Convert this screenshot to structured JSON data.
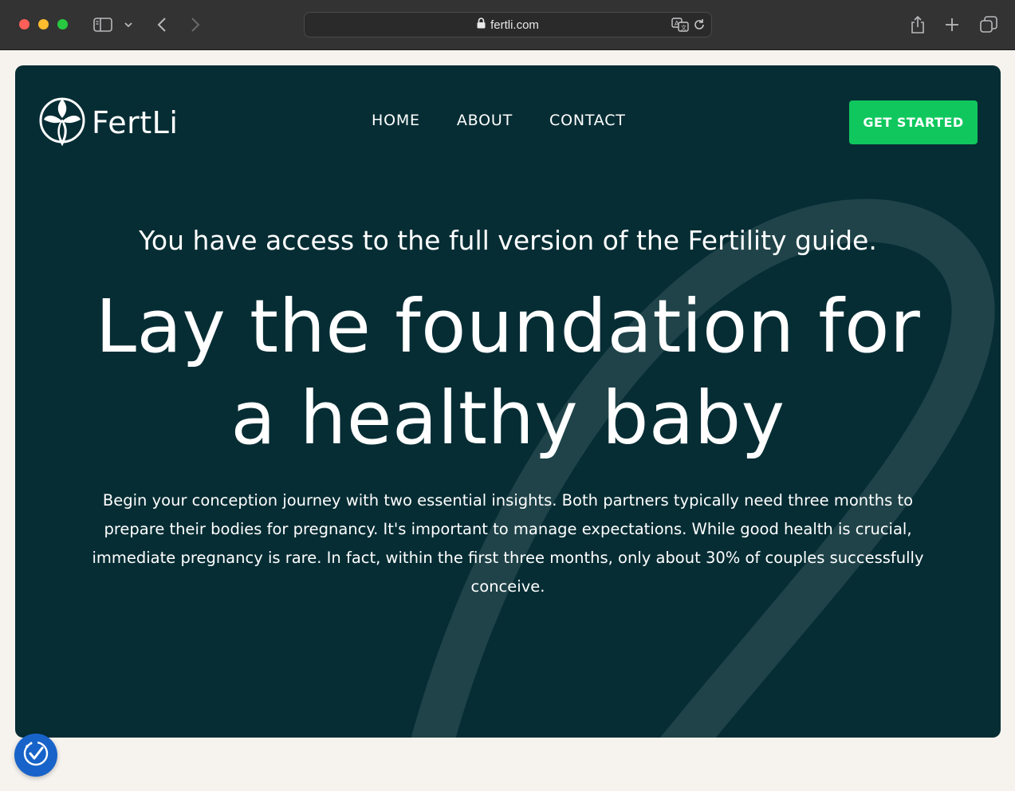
{
  "browser": {
    "url": "fertli.com",
    "icons": {
      "sidebar": "sidebar-icon",
      "chevron": "chevron-down-icon",
      "back": "back-arrow-icon",
      "forward": "forward-arrow-icon",
      "lock": "lock-icon",
      "translate": "translate-icon",
      "reload": "reload-icon",
      "share": "share-icon",
      "new_tab": "plus-icon",
      "tab_overview": "tabs-icon"
    }
  },
  "site": {
    "logo_text": "FertLi",
    "nav": {
      "home": "HOME",
      "about": "ABOUT",
      "contact": "CONTACT"
    },
    "cta_label": "GET STARTED",
    "access_line": "You have access to the full version of the Fertility guide.",
    "headline_line1": "Lay the foundation for",
    "headline_line2": "a healthy baby",
    "body": "Begin your conception journey with two essential insights. Both partners typically need three months to prepare their bodies for pregnancy. It's important to manage expectations. While good health is crucial, immediate pregnancy is rare. In fact, within the first three months, only about 30% of couples successfully conceive."
  },
  "colors": {
    "hero_bg": "#062d34",
    "cta_bg": "#10c75d",
    "page_bg": "#f6f3ef",
    "accessibility_button": "#1763c9"
  }
}
